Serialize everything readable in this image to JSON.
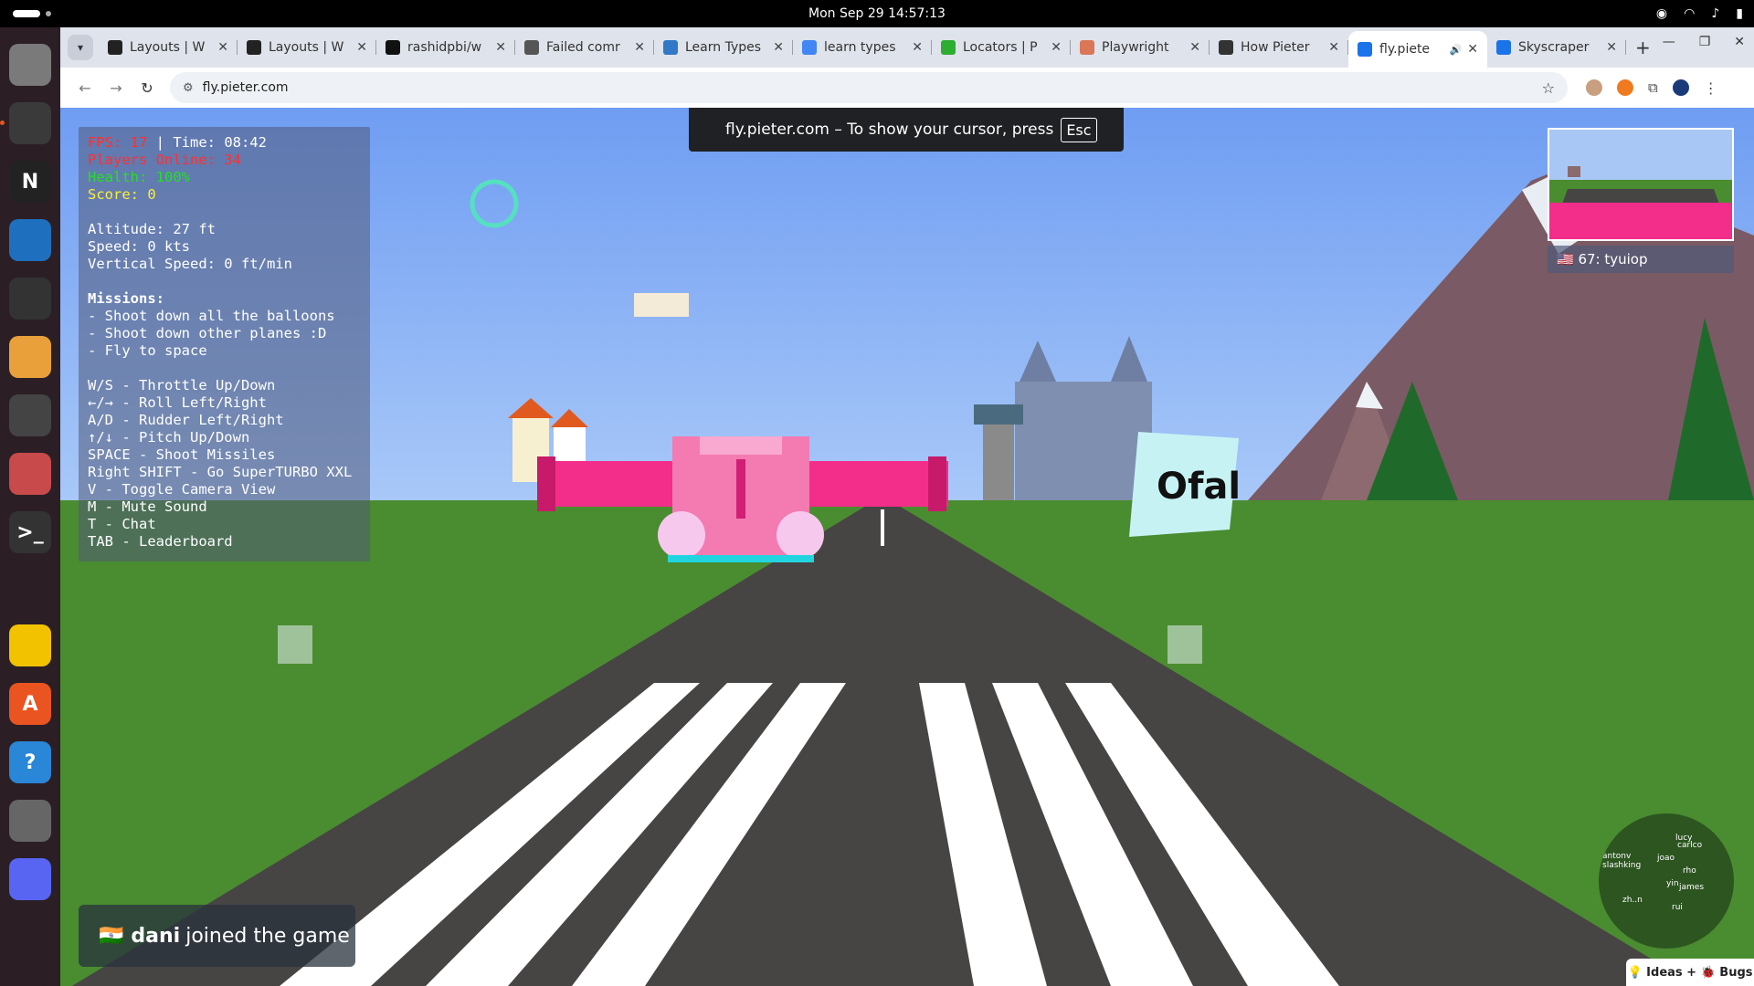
{
  "system": {
    "datetime": "Mon Sep 29  14:57:13"
  },
  "dock": {
    "apps": [
      {
        "name": "files-icon",
        "color": "#7a7a7a",
        "glyph": ""
      },
      {
        "name": "chrome-icon",
        "color": "#3a3a3a",
        "glyph": ""
      },
      {
        "name": "notion-icon",
        "color": "#222222",
        "glyph": "N"
      },
      {
        "name": "vscode-icon",
        "color": "#1f6fbf",
        "glyph": ""
      },
      {
        "name": "clock-icon",
        "color": "#333333",
        "glyph": ""
      },
      {
        "name": "text-editor-icon",
        "color": "#e9a03a",
        "glyph": ""
      },
      {
        "name": "magnifier-icon",
        "color": "#444444",
        "glyph": ""
      },
      {
        "name": "screenshot-icon",
        "color": "#c94a4a",
        "glyph": ""
      },
      {
        "name": "terminal-icon",
        "color": "#333333",
        "glyph": ">_"
      },
      {
        "name": "rhythmbox-icon",
        "color": "#f2c200",
        "glyph": ""
      },
      {
        "name": "app-center-icon",
        "color": "#e95420",
        "glyph": "A"
      },
      {
        "name": "help-icon",
        "color": "#2a86d6",
        "glyph": "?"
      },
      {
        "name": "settings-icon",
        "color": "#666666",
        "glyph": ""
      },
      {
        "name": "discord-icon",
        "color": "#5865f2",
        "glyph": ""
      },
      {
        "name": "show-apps-icon",
        "color": "#2b1f25",
        "glyph": ""
      }
    ]
  },
  "browser": {
    "tabs": [
      {
        "title": "Layouts | W",
        "fav": "#222222"
      },
      {
        "title": "Layouts | W",
        "fav": "#222222"
      },
      {
        "title": "rashidpbi/w",
        "fav": "#111111"
      },
      {
        "title": "Failed comr",
        "fav": "#555555"
      },
      {
        "title": "Learn Types",
        "fav": "#3178c6"
      },
      {
        "title": "learn types",
        "fav": "#4285f4"
      },
      {
        "title": "Locators | P",
        "fav": "#2ead33"
      },
      {
        "title": "Playwright",
        "fav": "#d97757"
      },
      {
        "title": "How Pieter",
        "fav": "#333333"
      },
      {
        "title": "fly.piete",
        "fav": "#1a73e8",
        "active": true
      },
      {
        "title": "Skyscraper",
        "fav": "#1a73e8"
      }
    ],
    "url": "fly.pieter.com",
    "fullscreen_notice": "fly.pieter.com – To show your cursor, press",
    "fullscreen_key": "Esc"
  },
  "hud": {
    "fps": "FPS: 17",
    "time": " | Time: 08:42",
    "players": "Players Online: 34",
    "health": "Health: 100%",
    "score": "Score: 0",
    "altitude": "Altitude: 27 ft",
    "speed": "Speed: 0 kts",
    "vspeed": "Vertical Speed: 0 ft/min",
    "missions_title": "Missions:",
    "missions": [
      "- Shoot down all the balloons",
      "- Shoot down other planes :D",
      "- Fly to space"
    ],
    "controls": [
      "W/S - Throttle Up/Down",
      "←/→ - Roll Left/Right",
      "A/D - Rudder Left/Right",
      "↑/↓ - Pitch Up/Down",
      "SPACE - Shoot Missiles",
      "Right SHIFT - Go SuperTURBO XXL",
      "V - Toggle Camera View",
      "M - Mute Sound",
      "T - Chat",
      "TAB - Leaderboard"
    ]
  },
  "player_tag": "🇺🇸 67: tyuiop",
  "billboard": "Ofal",
  "radar_names": [
    "antonv",
    "slashking",
    "joao",
    "lucy",
    "carlco",
    "rho",
    "james",
    "yin",
    "rui",
    "zh..n"
  ],
  "toast": {
    "flag": "🇮🇳",
    "name": "dani",
    "text": "joined the game"
  },
  "feedback": "💡 Ideas + 🐞 Bugs"
}
